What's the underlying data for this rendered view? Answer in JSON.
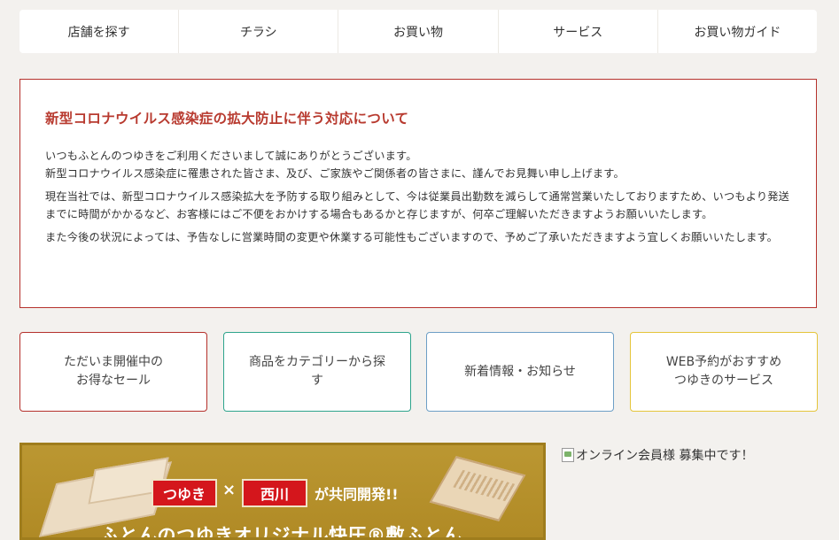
{
  "nav": {
    "items": [
      {
        "label": "店舗を探す"
      },
      {
        "label": "チラシ"
      },
      {
        "label": "お買い物"
      },
      {
        "label": "サービス"
      },
      {
        "label": "お買い物ガイド"
      }
    ]
  },
  "notice": {
    "title": "新型コロナウイルス感染症の拡大防止に伴う対応について",
    "p1_line1": "いつもふとんのつゆきをご利用くださいまして誠にありがとうございます。",
    "p1_line2": "新型コロナウイルス感染症に罹患された皆さま、及び、ご家族やご関係者の皆さまに、謹んでお見舞い申し上げます。",
    "p2": "現在当社では、新型コロナウイルス感染拡大を予防する取り組みとして、今は従業員出勤数を減らして通常営業いたしておりますため、いつもより発送までに時間がかかるなど、お客様にはご不便をおかけする場合もあるかと存じますが、何卒ご理解いただきますようお願いいたします。",
    "p3": "また今後の状況によっては、予告なしに営業時間の変更や休業する可能性もございますので、予めご了承いただきますよう宜しくお願いいたします。"
  },
  "cards": [
    {
      "line1": "ただいま開催中の",
      "line2": "お得なセール"
    },
    {
      "line1": "商品をカテゴリーから探",
      "line2": "す"
    },
    {
      "line1": "新着情報・お知らせ",
      "line2": ""
    },
    {
      "line1": "WEB予約がおすすめ",
      "line2": "つゆきのサービス"
    }
  ],
  "banner": {
    "tag1": "つゆき",
    "times": "×",
    "tag2": "西川",
    "joint": "が共同開発!!",
    "title": "ふとんのつゆきオリジナル快圧®敷ふとん"
  },
  "side_image": {
    "alt": "オンライン会員様 募集中です！",
    "icon": "broken-image-icon"
  },
  "colors": {
    "accent_red": "#b5312c",
    "card_green": "#2ea48c",
    "card_blue": "#6d9fc6",
    "card_yellow": "#e5c53a",
    "banner_gold": "#b4902a"
  }
}
